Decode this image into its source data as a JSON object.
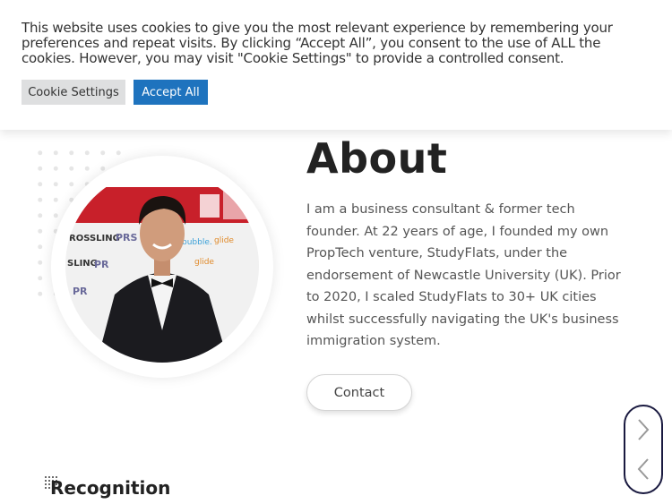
{
  "cookie_banner": {
    "text": "This website uses cookies to give you the most relevant experience by remembering your preferences and repeat visits. By clicking “Accept All”, you consent to the use of ALL the cookies. However, you may visit \"Cookie Settings\" to provide a controlled consent.",
    "settings_label": "Cookie Settings",
    "accept_label": "Accept All",
    "accept_color": "#1e73be"
  },
  "about": {
    "title": "About",
    "body": "I am a business consultant & former tech founder. At 22 years of age, I founded my own PropTech venture, StudyFlats, under the endorsement of Newcastle University (UK). Prior to 2020, I scaled StudyFlats to 30+ UK cities whilst successfully navigating the UK's business immigration system.",
    "contact_label": "Contact"
  },
  "carousel_nav": {
    "next_icon": "chevron-right-icon",
    "prev_icon": "chevron-left-icon"
  },
  "recognition": {
    "title": "Recognition"
  }
}
